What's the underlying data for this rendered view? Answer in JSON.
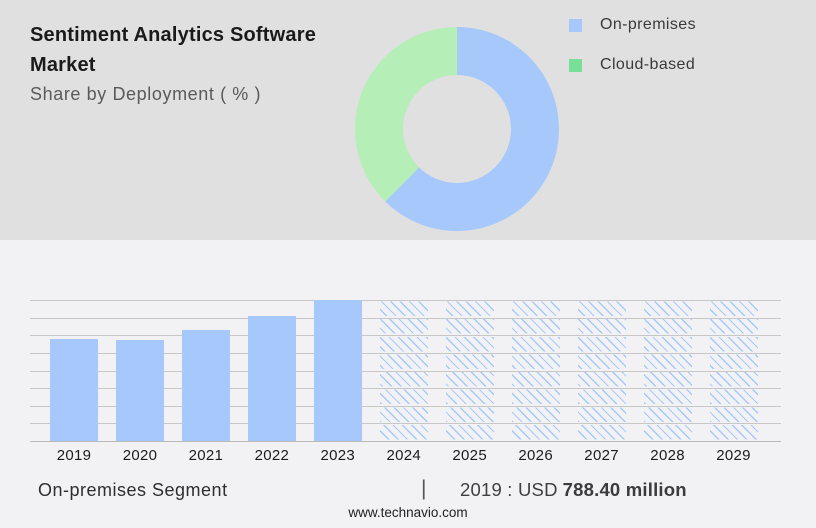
{
  "header": {
    "title": "Sentiment Analytics Software Market",
    "subtitle": "Share by Deployment ( % )"
  },
  "legend": {
    "items": [
      {
        "label": "On-premises",
        "color": "#a6c8fa"
      },
      {
        "label": "Cloud-based",
        "color": "#77e096"
      }
    ]
  },
  "footer": {
    "segment_label": "On-premises Segment",
    "separator": "|",
    "value_prefix": "2019 : USD",
    "value_bold": "788.40 million",
    "website": "www.technavio.com"
  },
  "colors": {
    "top_background": "#e0e0e1",
    "bottom_background": "#f2f2f4",
    "bar_blue": "#a6c8fa",
    "donut_blue": "#a6c8fa",
    "donut_green": "#b6eeb8",
    "legend_green": "#77e096",
    "gridline": "#c7c7c8"
  },
  "chart_data": [
    {
      "type": "pie",
      "subtype": "donut",
      "title": "Share by Deployment ( % )",
      "labels": [
        "On-premises",
        "Cloud-based"
      ],
      "values_pct": [
        62.4,
        37.6
      ],
      "colors": [
        "#a6c8fa",
        "#b6eeb8"
      ],
      "start_angle_deg": 0,
      "direction": "clockwise",
      "legend_position": "right"
    },
    {
      "type": "bar",
      "title": "On-premises Segment",
      "categories": [
        "2019",
        "2020",
        "2021",
        "2022",
        "2023",
        "2024",
        "2025",
        "2026",
        "2027",
        "2028",
        "2029"
      ],
      "values_pct_of_max": [
        72.7,
        72.0,
        79.1,
        88.7,
        100,
        100,
        100,
        100,
        100,
        100,
        100
      ],
      "hatched_forecast": [
        false,
        false,
        false,
        false,
        false,
        true,
        true,
        true,
        true,
        true,
        true
      ],
      "labeled_value": {
        "year": "2019",
        "value": "USD 788.40 million"
      },
      "gridlines": 9,
      "grid": "horizontal",
      "ylim_pct": [
        0,
        100
      ]
    }
  ]
}
